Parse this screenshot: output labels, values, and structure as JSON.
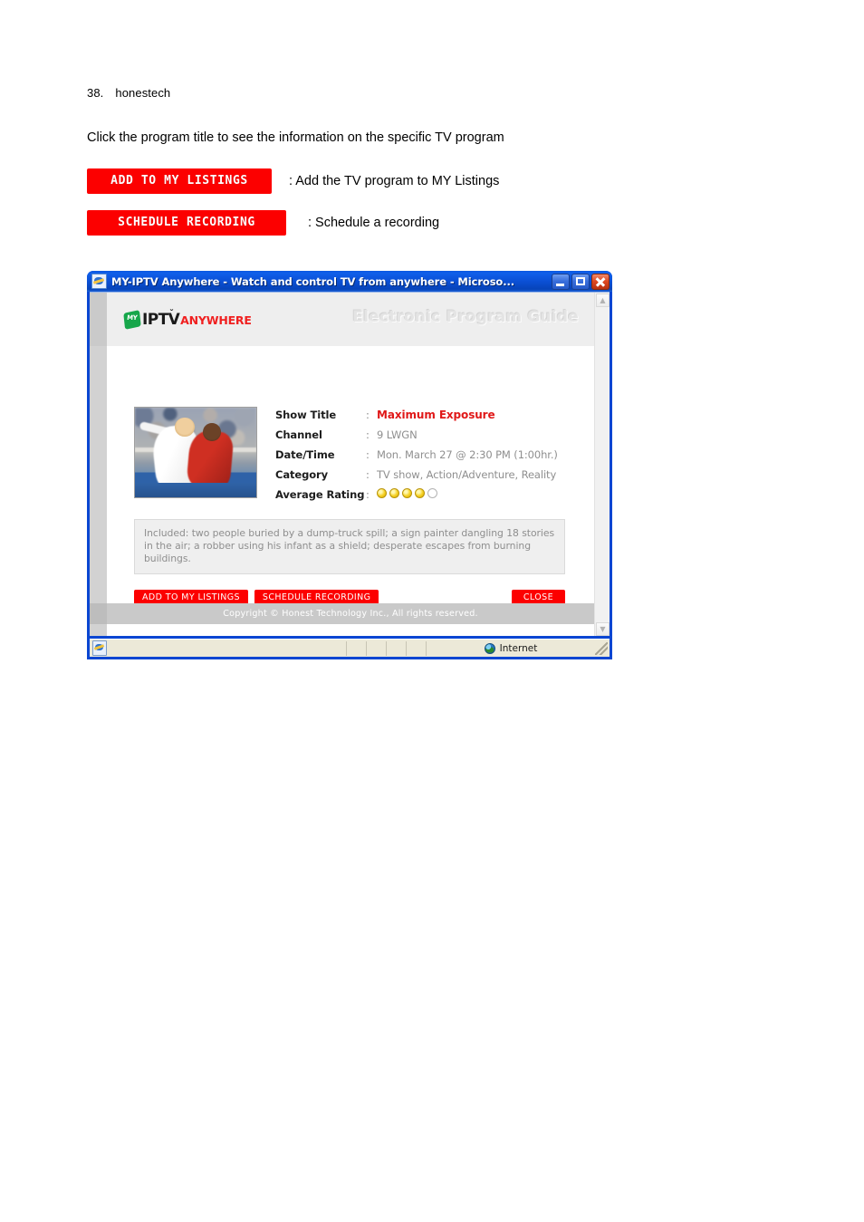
{
  "document": {
    "page_number": "38.",
    "brand": "honestech",
    "intro": "Click the program title to see the information on the specific TV program",
    "legend": [
      {
        "button_label": "ADD TO MY LISTINGS",
        "description": ": Add the TV program to MY Listings"
      },
      {
        "button_label": "SCHEDULE RECORDING",
        "description": ": Schedule a recording"
      }
    ]
  },
  "browser": {
    "title": "MY-IPTV Anywhere - Watch and control TV from anywhere - Microso...",
    "window_buttons": {
      "minimize": "minimize-icon",
      "maximize": "maximize-icon",
      "close": "close-icon"
    },
    "status": {
      "zone_label": "Internet",
      "zone_icon": "globe-icon"
    }
  },
  "site": {
    "logo": {
      "badge": "MY",
      "main": "IPTV",
      "suffix": "ANYWHERE",
      "check": "ˇ"
    },
    "header_title": "Electronic Program Guide",
    "footer": "Copyright © Honest Technology Inc., All rights reserved."
  },
  "program": {
    "thumbnail_alt": "soccer-players-photo",
    "fields": [
      {
        "label": "Show Title",
        "colon": ":",
        "value": "Maximum Exposure",
        "highlight": true
      },
      {
        "label": "Channel",
        "colon": ":",
        "value": "9 LWGN"
      },
      {
        "label": "Date/Time",
        "colon": ":",
        "value": "Mon. March 27 @ 2:30 PM (1:00hr.)"
      },
      {
        "label": "Category",
        "colon": ":",
        "value": "TV show, Action/Adventure, Reality"
      }
    ],
    "rating": {
      "label": "Average Rating",
      "colon": ":",
      "filled": 4,
      "total": 5
    },
    "description": "Included: two people buried by a dump-truck spill; a sign painter dangling 18 stories in the air; a robber using his infant as a shield; desperate escapes from burning buildings.",
    "actions": {
      "add": "ADD TO MY LISTINGS",
      "schedule": "SCHEDULE RECORDING",
      "close": "CLOSE"
    }
  },
  "colors": {
    "red_button": "#fc0000",
    "title_red": "#e01818",
    "titlebar_blue": "#0b4fd4",
    "logo_green": "#16a64a",
    "logo_red": "#f02020"
  }
}
